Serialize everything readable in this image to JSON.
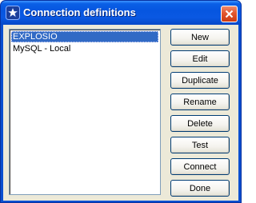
{
  "window": {
    "title": "Connection definitions"
  },
  "connections": {
    "items": [
      {
        "label": "EXPLOSIO",
        "selected": true
      },
      {
        "label": "MySQL - Local",
        "selected": false
      }
    ]
  },
  "buttons": {
    "new": "New",
    "edit": "Edit",
    "duplicate": "Duplicate",
    "rename": "Rename",
    "delete": "Delete",
    "test": "Test",
    "connect": "Connect",
    "done": "Done"
  },
  "icons": {
    "app": "star-app-icon",
    "close": "close-icon"
  },
  "colors": {
    "titlebar": "#0656e0",
    "selection": "#316ac5",
    "close_button": "#e2562e",
    "dialog_face": "#ece9d8"
  }
}
